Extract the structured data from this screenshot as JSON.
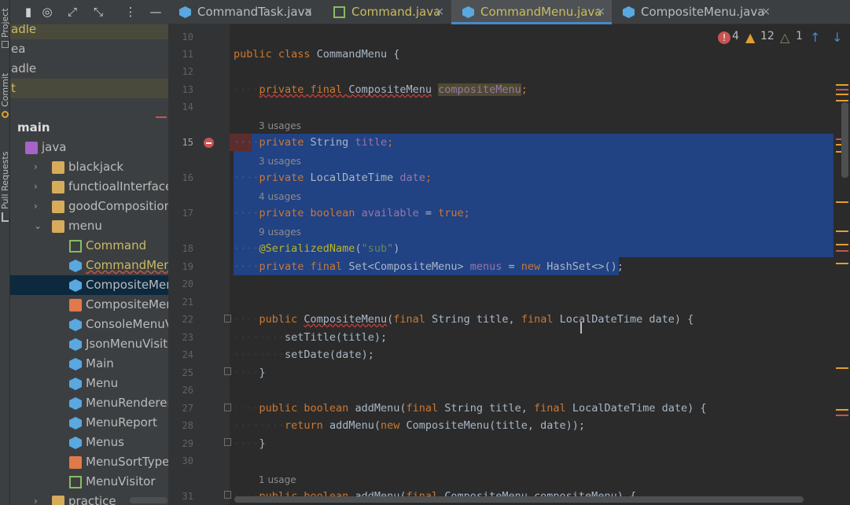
{
  "side_stripe": {
    "project": "Project",
    "commit": "Commit",
    "pull_requests": "Pull Requests"
  },
  "project_tree": {
    "rows": [
      {
        "label": "adle",
        "icon": "none",
        "arrow": "",
        "state": "highlight"
      },
      {
        "label": "ea",
        "icon": "none",
        "arrow": "",
        "state": ""
      },
      {
        "label": "adle",
        "icon": "none",
        "arrow": "",
        "state": ""
      },
      {
        "label": "t",
        "icon": "none",
        "arrow": "",
        "state": "highlight"
      },
      {
        "label": "",
        "icon": "none",
        "arrow": "",
        "state": ""
      },
      {
        "label": "main",
        "icon": "none",
        "arrow": "",
        "state": "bold"
      },
      {
        "label": "java",
        "icon": "source-folder-icon",
        "arrow": "",
        "state": ""
      },
      {
        "label": "blackjack",
        "icon": "folder-icon",
        "arrow": "›",
        "state": ""
      },
      {
        "label": "functioalInterface",
        "icon": "folder-icon",
        "arrow": "›",
        "state": ""
      },
      {
        "label": "goodComposition",
        "icon": "folder-icon",
        "arrow": "›",
        "state": ""
      },
      {
        "label": "menu",
        "icon": "folder-icon",
        "arrow": "⌄",
        "state": ""
      },
      {
        "label": "Command",
        "icon": "interface-icon",
        "arrow": "",
        "state": "modified"
      },
      {
        "label": "CommandMenu",
        "icon": "class-icon",
        "arrow": "",
        "state": "modified-err"
      },
      {
        "label": "CompositeMenu",
        "icon": "class-icon",
        "arrow": "",
        "state": "selected"
      },
      {
        "label": "CompositeMenuSo",
        "icon": "enum-icon",
        "arrow": "",
        "state": ""
      },
      {
        "label": "ConsoleMenuVisito",
        "icon": "class-icon",
        "arrow": "",
        "state": ""
      },
      {
        "label": "JsonMenuVisitor",
        "icon": "class-icon",
        "arrow": "",
        "state": ""
      },
      {
        "label": "Main",
        "icon": "main-class-icon",
        "arrow": "",
        "state": ""
      },
      {
        "label": "Menu",
        "icon": "class-icon",
        "arrow": "",
        "state": ""
      },
      {
        "label": "MenuRenderer",
        "icon": "class-icon",
        "arrow": "",
        "state": ""
      },
      {
        "label": "MenuReport",
        "icon": "class-icon",
        "arrow": "",
        "state": ""
      },
      {
        "label": "Menus",
        "icon": "class-icon",
        "arrow": "",
        "state": ""
      },
      {
        "label": "MenuSortType",
        "icon": "enum-icon",
        "arrow": "",
        "state": ""
      },
      {
        "label": "MenuVisitor",
        "icon": "interface-icon",
        "arrow": "",
        "state": ""
      },
      {
        "label": "practice",
        "icon": "folder-icon",
        "arrow": "›",
        "state": ""
      }
    ]
  },
  "tabs": [
    {
      "label": "CommandTask.java",
      "icon": "class-icon",
      "color": "#bbbbbb",
      "active": false
    },
    {
      "label": "Command.java",
      "icon": "interface-icon",
      "color": "#c9bb63",
      "active": false
    },
    {
      "label": "CommandMenu.java",
      "icon": "class-icon",
      "color": "#c9bb63",
      "active": true
    },
    {
      "label": "CompositeMenu.java",
      "icon": "class-icon",
      "color": "#bbbbbb",
      "active": false
    }
  ],
  "inspections": {
    "errors": "4",
    "warnings": "12",
    "weak_warnings": "1"
  },
  "line_numbers": [
    "10",
    "11",
    "12",
    "13",
    "14",
    "15",
    "16",
    "17",
    "18",
    "19",
    "20",
    "21",
    "22",
    "23",
    "24",
    "25",
    "26",
    "27",
    "28",
    "29",
    "30",
    "31"
  ],
  "usages": {
    "u15": "3 usages",
    "u16": "3 usages",
    "u17": "4 usages",
    "u18": "9 usages",
    "u31": "1 usage"
  },
  "code": {
    "l11_kw": "public class ",
    "l11_name": "CommandMenu {",
    "l13_kw": "private final ",
    "l13_type": "CompositeMenu",
    "l13_field": "compositeMenu",
    "l13_end": ";",
    "l15_kw": "private ",
    "l15_type": "String ",
    "l15_field": "title",
    "l15_end": ";",
    "l16_kw": "private ",
    "l16_type": "LocalDateTime ",
    "l16_field": "date",
    "l16_end": ";",
    "l17_kw": "private boolean ",
    "l17_field": "available",
    "l17_eq": " = ",
    "l17_val": "true",
    "l17_end": ";",
    "l18_ann": "@SerializedName",
    "l18_open": "(",
    "l18_str": "\"sub\"",
    "l18_close": ")",
    "l19_kw": "private final ",
    "l19_type": "Set<CompositeMenu> ",
    "l19_field": "menus",
    "l19_eq": " = ",
    "l19_new": "new ",
    "l19_rest": "HashSet<>();",
    "l22_kw": "public ",
    "l22_name": "CompositeMenu",
    "l22_open": "(",
    "l22_f1": "final ",
    "l22_p1": "String title, ",
    "l22_f2": "final ",
    "l22_p2": "LocalDateTime date) {",
    "l23": "setTitle(title);",
    "l24": "setDate(date);",
    "l25": "}",
    "l27_kw": "public boolean ",
    "l27_name": "addMenu(",
    "l27_f1": "final ",
    "l27_p1": "String title, ",
    "l27_f2": "final ",
    "l27_p2": "LocalDateTime date) {",
    "l28_kw": "return ",
    "l28_a": "addMenu(",
    "l28_new": "new ",
    "l28_b": "CompositeMenu(title, date));",
    "l29": "}",
    "l31_kw": "public boolean ",
    "l31_name": "addMenu(",
    "l31_f": "final ",
    "l31_p": "CompositeMenu compositeMenu) {"
  },
  "colors": {
    "selection": "#214283",
    "keyword": "#cc7832",
    "field": "#9876aa",
    "string": "#6a8759",
    "annotation": "#bbb529",
    "error": "#c75450",
    "warning": "#e0a030"
  }
}
